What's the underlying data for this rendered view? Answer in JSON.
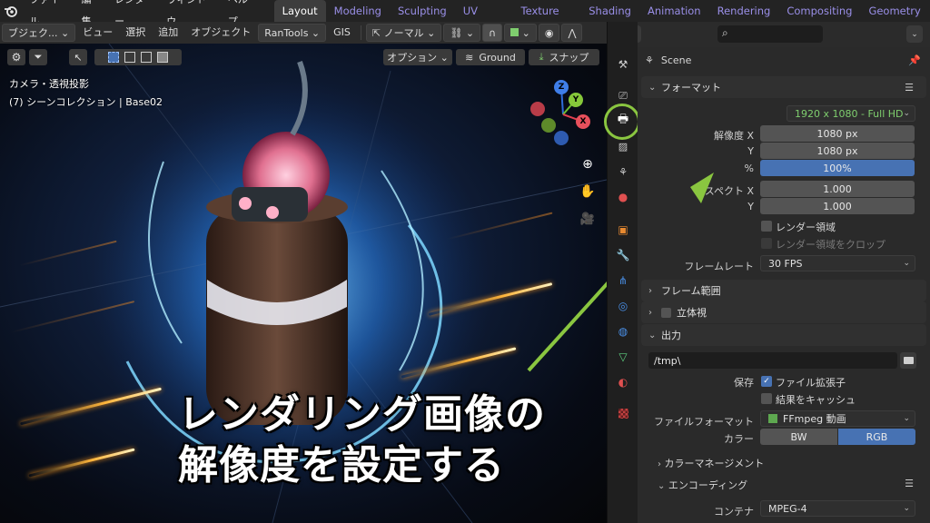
{
  "menubar": {
    "items": [
      "ファイル",
      "編集",
      "レンダー",
      "ウィンドウ",
      "ヘルプ"
    ],
    "workspaces": [
      "Layout",
      "Modeling",
      "Sculpting",
      "UV Editing",
      "Texture Paint",
      "Shading",
      "Animation",
      "Rendering",
      "Compositing",
      "Geometry No"
    ],
    "active_workspace": "Layout"
  },
  "viewport_header": {
    "mode": "ブジェク...",
    "view": "ビュー",
    "select": "選択",
    "add": "追加",
    "object": "オブジェクト",
    "rantools": "RanTools",
    "gis": "GIS",
    "normal": "ノーマル"
  },
  "viewport": {
    "options": "オプション",
    "ground": "Ground",
    "snap": "スナップ",
    "camera_label": "カメラ・透視投影",
    "collection_label": "(7) シーンコレクション | Base02",
    "gizmo": {
      "x": "X",
      "y": "Y",
      "z": "Z"
    },
    "caption_line1": "レンダリング画像の",
    "caption_line2": "解像度を設定する"
  },
  "properties": {
    "scene": "Scene",
    "format": {
      "title": "フォーマット",
      "preset": "1920 x 1080 - Full HD",
      "res_x_label": "解像度 X",
      "res_x": "1080 px",
      "res_y_label": "Y",
      "res_y": "1080 px",
      "percent_label": "%",
      "percent": "100%",
      "aspect_x_label": "スペクト X",
      "aspect_x": "1.000",
      "aspect_y_label": "Y",
      "aspect_y": "1.000",
      "render_region": "レンダー領域",
      "crop_region": "レンダー領域をクロップ",
      "framerate_label": "フレームレート",
      "framerate": "30 FPS"
    },
    "frame_range": "フレーム範囲",
    "stereoscopy": "立体視",
    "output": {
      "title": "出力",
      "path": "/tmp\\",
      "save_label": "保存",
      "file_ext": "ファイル拡張子",
      "cache": "結果をキャッシュ",
      "file_format_label": "ファイルフォーマット",
      "file_format": "FFmpeg 動画",
      "color_label": "カラー",
      "color_bw": "BW",
      "color_rgb": "RGB",
      "color_management": "カラーマネージメント",
      "encoding": "エンコーディング",
      "container_label": "コンテナ",
      "container": "MPEG-4"
    }
  }
}
